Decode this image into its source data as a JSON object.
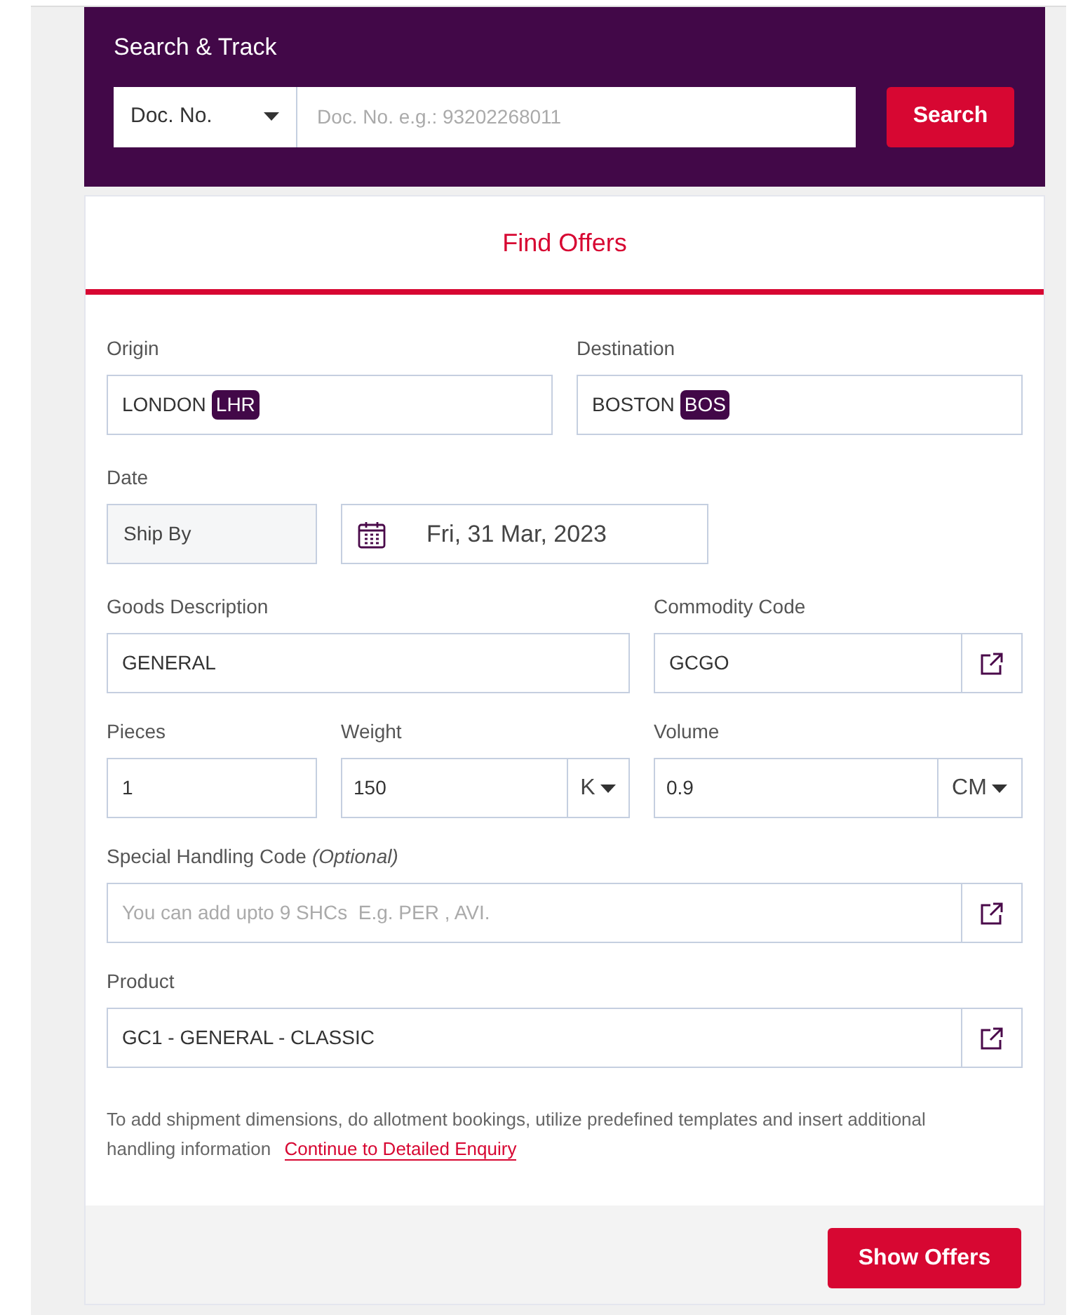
{
  "search_track": {
    "title": "Search & Track",
    "doc_type": "Doc. No.",
    "placeholder": "Doc. No. e.g.: 93202268011",
    "button": "Search"
  },
  "find_offers": {
    "title": "Find Offers",
    "origin": {
      "label": "Origin",
      "city": "LONDON",
      "code": "LHR"
    },
    "destination": {
      "label": "Destination",
      "city": "BOSTON",
      "code": "BOS"
    },
    "date": {
      "label": "Date",
      "type": "Ship By",
      "value": "Fri, 31 Mar, 2023"
    },
    "goods_description": {
      "label": "Goods Description",
      "value": "GENERAL"
    },
    "commodity_code": {
      "label": "Commodity Code",
      "value": "GCGO"
    },
    "pieces": {
      "label": "Pieces",
      "value": "1"
    },
    "weight": {
      "label": "Weight",
      "value": "150",
      "unit": "K"
    },
    "volume": {
      "label": "Volume",
      "value": "0.9",
      "unit": "CM"
    },
    "shc": {
      "label": "Special Handling Code",
      "optional": "(Optional)",
      "placeholder": "You can add upto 9 SHCs  E.g. PER , AVI."
    },
    "product": {
      "label": "Product",
      "value": "GC1 - GENERAL - CLASSIC"
    },
    "note": "To add shipment dimensions, do allotment bookings, utilize predefined templates and insert additional handling information",
    "link": "Continue to Detailed Enquiry",
    "button": "Show Offers"
  }
}
